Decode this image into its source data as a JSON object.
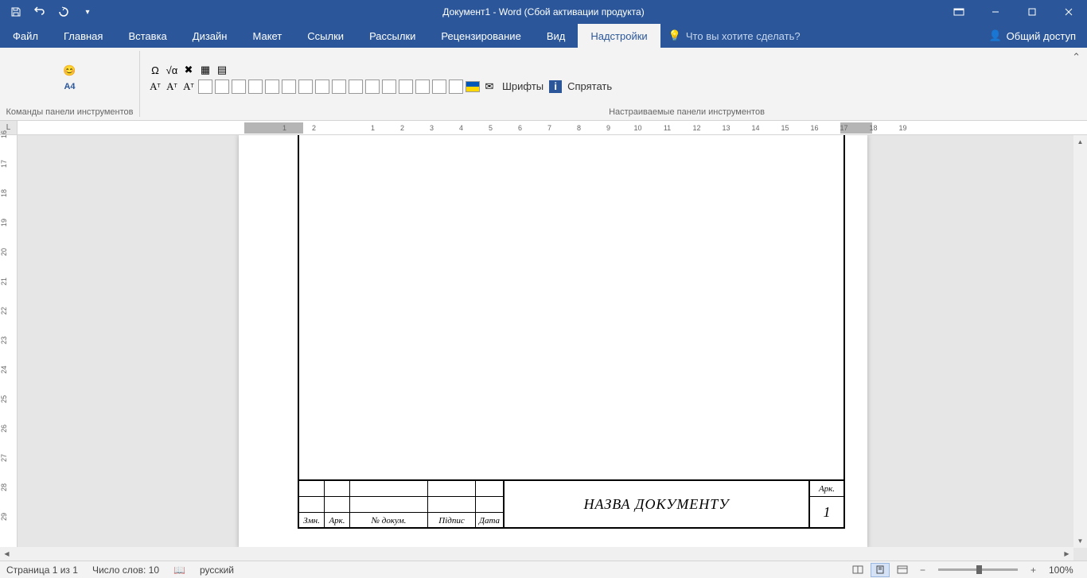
{
  "titlebar": {
    "title": "Документ1 - Word (Сбой активации продукта)"
  },
  "tabs": {
    "file": "Файл",
    "home": "Главная",
    "insert": "Вставка",
    "design": "Дизайн",
    "layout": "Макет",
    "references": "Ссылки",
    "mailings": "Рассылки",
    "review": "Рецензирование",
    "view": "Вид",
    "addins": "Надстройки",
    "tellme": "Что вы хотите сделать?",
    "share": "Общий доступ"
  },
  "ribbon": {
    "group1_label": "Команды панели инструментов",
    "group2_label": "Настраиваемые панели инструментов",
    "a4": "А4",
    "fonts": "Шрифты",
    "hide": "Спрятать"
  },
  "document": {
    "title": "НАЗВА ДОКУМЕНТУ",
    "zmn": "Змн.",
    "ark": "Арк.",
    "dokum": "№ докум.",
    "pidpys": "Підпис",
    "data": "Дата",
    "ark_label": "Арк.",
    "page_num": "1"
  },
  "statusbar": {
    "page": "Страница 1 из 1",
    "words": "Число слов: 10",
    "lang": "русский",
    "zoom": "100%"
  },
  "ruler_h": [
    "",
    "1",
    "2",
    "",
    "1",
    "2",
    "3",
    "4",
    "5",
    "6",
    "7",
    "8",
    "9",
    "10",
    "11",
    "12",
    "13",
    "14",
    "15",
    "16",
    "17",
    "18",
    "19",
    ""
  ],
  "ruler_v": [
    "16",
    "17",
    "18",
    "19",
    "20",
    "21",
    "22",
    "23",
    "24",
    "25",
    "26",
    "27",
    "28",
    "29"
  ]
}
